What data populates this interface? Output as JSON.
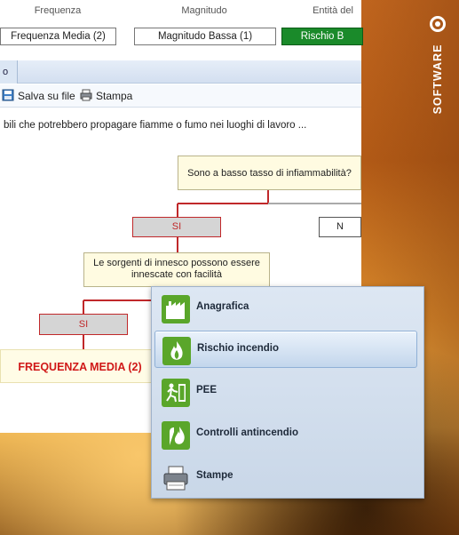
{
  "brand": {
    "text": "SOFTWARE"
  },
  "columns": [
    {
      "header": "Frequenza",
      "value": "Frequenza Media (2)"
    },
    {
      "header": "Magnitudo",
      "value": "Magnitudo Bassa (1)"
    },
    {
      "header": "Entità del",
      "value": "Rischio B"
    }
  ],
  "tab": {
    "label": "o"
  },
  "toolbar": {
    "save_label": "Salva su file",
    "print_label": "Stampa"
  },
  "question": "bili che potrebbero propagare fiamme o fumo nei luoghi di lavoro ...",
  "flow": {
    "q1": "Sono a basso tasso di infiammabilità?",
    "si1": "SI",
    "no1": "N",
    "q2": "Le sorgenti di innesco possono essere innescate con facilità",
    "si2": "SI",
    "result": "FREQUENZA MEDIA (2)"
  },
  "menu": {
    "items": [
      {
        "label": "Anagrafica",
        "icon": "factory-icon"
      },
      {
        "label": "Rischio incendio",
        "icon": "flame-icon",
        "selected": true
      },
      {
        "label": "PEE",
        "icon": "emergency-exit-icon"
      },
      {
        "label": "Controlli antincendio",
        "icon": "fire-control-icon"
      },
      {
        "label": "Stampe",
        "icon": "printer-icon"
      }
    ]
  },
  "colors": {
    "green": "#1a8a2a",
    "accent_red": "#d01818",
    "line_red": "#c0282a"
  }
}
